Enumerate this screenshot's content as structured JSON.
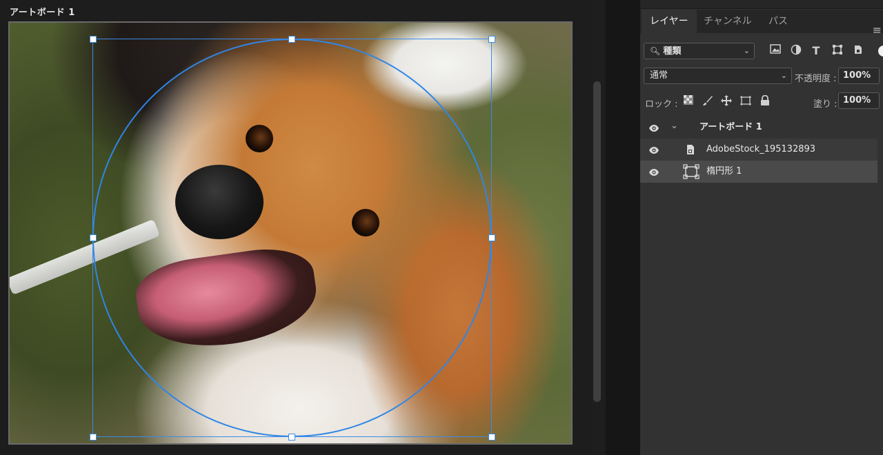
{
  "canvas": {
    "artboard_label": "アートボード 1"
  },
  "layers_panel": {
    "tabs": [
      {
        "label": "レイヤー",
        "active": true
      },
      {
        "label": "チャンネル",
        "active": false
      },
      {
        "label": "パス",
        "active": false
      }
    ],
    "filter": {
      "selected": "種類",
      "icons": [
        "image-filter-icon",
        "adjustment-filter-icon",
        "type-filter-icon",
        "shape-filter-icon",
        "smart-object-filter-icon"
      ]
    },
    "blend_mode": "通常",
    "opacity_label": "不透明度 :",
    "opacity_value": "100%",
    "lock_label": "ロック :",
    "fill_label": "塗り :",
    "fill_value": "100%",
    "layers": [
      {
        "name": "アートボード 1",
        "type": "artboard",
        "visible": true,
        "expanded": true
      },
      {
        "name": "AdobeStock_195132893",
        "type": "smart-object",
        "visible": true
      },
      {
        "name": "楕円形 1",
        "type": "shape",
        "visible": true,
        "selected": true
      }
    ]
  },
  "colors": {
    "selection": "#3b8be8",
    "panel_bg": "#323232",
    "app_bg": "#1d1d1d"
  }
}
